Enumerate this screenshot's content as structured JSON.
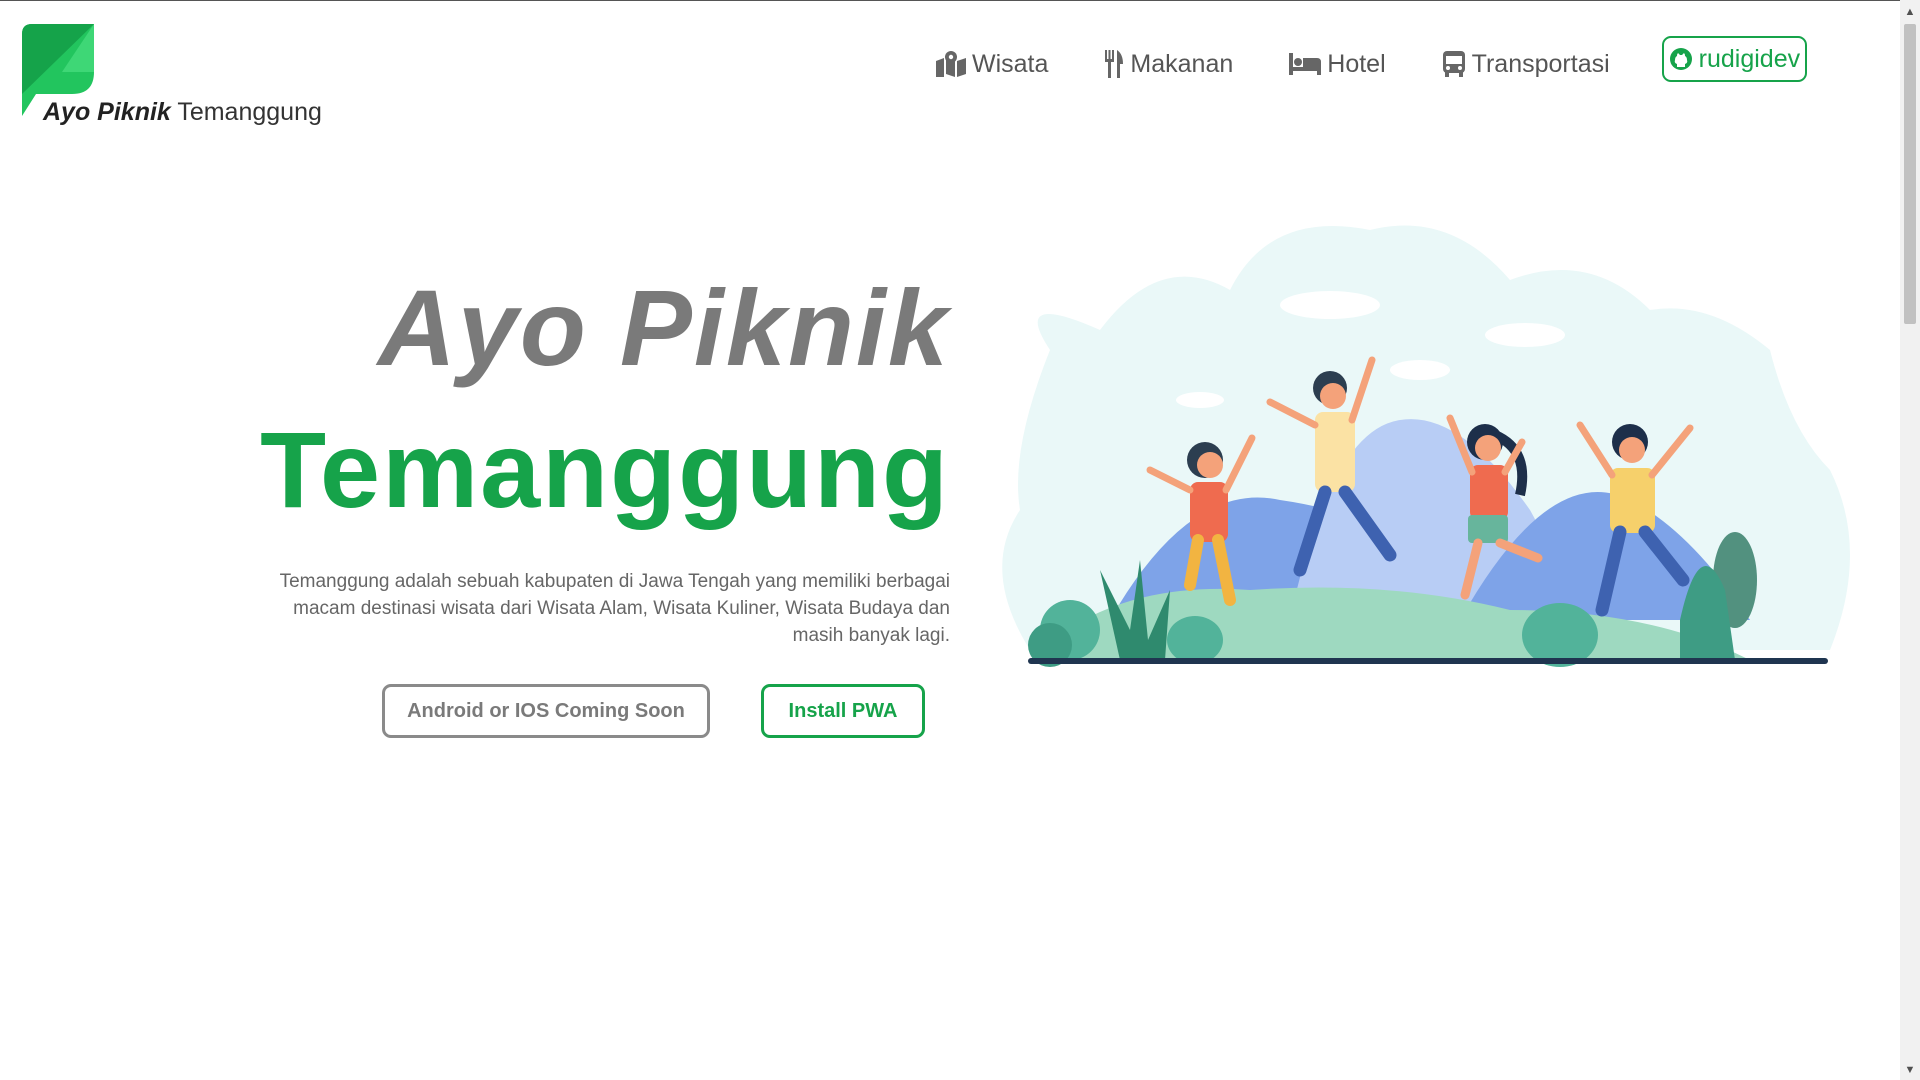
{
  "logo": {
    "brand": "Ayo Piknik",
    "city": "Temanggung"
  },
  "nav": {
    "items": [
      {
        "label": "Wisata",
        "icon": "map-marked-icon"
      },
      {
        "label": "Makanan",
        "icon": "utensils-icon"
      },
      {
        "label": "Hotel",
        "icon": "bed-icon"
      },
      {
        "label": "Transportasi",
        "icon": "bus-icon"
      }
    ],
    "github": {
      "label": "rudigidev",
      "icon": "github-icon"
    }
  },
  "hero": {
    "title_line1": "Ayo Piknik",
    "title_line2": "Temanggung",
    "description": "Temanggung adalah sebuah kabupaten di Jawa Tengah yang memiliki berbagai macam destinasi wisata dari Wisata Alam, Wisata Kuliner, Wisata Budaya dan masih banyak lagi.",
    "buttons": {
      "soon": "Android or IOS Coming Soon",
      "pwa": "Install PWA"
    }
  },
  "colors": {
    "brand_green": "#16a34a",
    "title_gray": "#7a7a7a",
    "text_gray": "#666666"
  }
}
